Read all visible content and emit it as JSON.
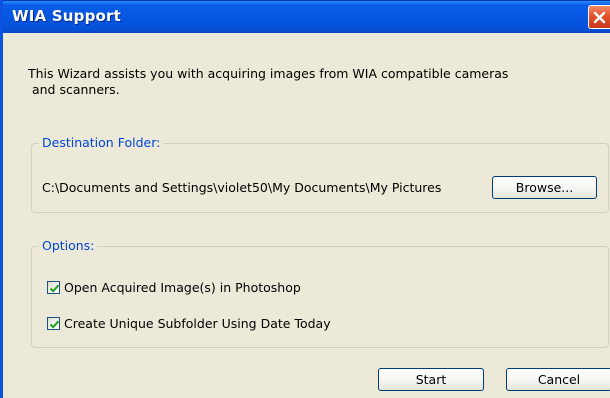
{
  "window": {
    "title": "WIA Support"
  },
  "intro": {
    "line1": "This Wizard assists you with acquiring images from WIA compatible cameras",
    "line2": " and scanners."
  },
  "destination": {
    "legend": "Destination Folder:",
    "path": "C:\\Documents and Settings\\violet50\\My Documents\\My Pictures",
    "browse_label": "Browse..."
  },
  "options": {
    "legend": "Options:",
    "items": [
      {
        "label": "Open Acquired Image(s) in Photoshop",
        "checked": true
      },
      {
        "label": "Create Unique Subfolder Using Date Today",
        "checked": true
      }
    ]
  },
  "footer": {
    "start_label": "Start",
    "cancel_label": "Cancel"
  },
  "icons": {
    "close": "close-icon",
    "check": "checkmark-icon"
  },
  "colors": {
    "titlebar": "#0657e3",
    "close": "#e2532c",
    "legend_text": "#0046d5",
    "checkmark": "#21a121",
    "dialog_bg": "#ece9d8"
  }
}
